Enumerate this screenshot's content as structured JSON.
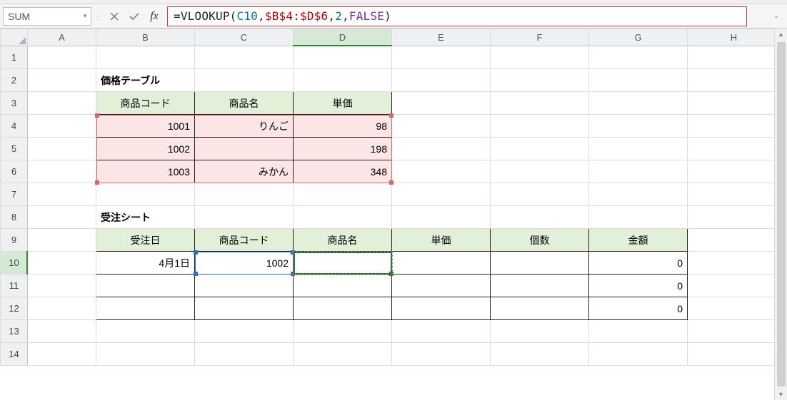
{
  "name_box": "SUM",
  "formula_tokens": [
    {
      "t": "=VLOOKUP",
      "c": "black"
    },
    {
      "t": "(",
      "c": "black"
    },
    {
      "t": "C10",
      "c": "blue"
    },
    {
      "t": ",",
      "c": "black"
    },
    {
      "t": "$B$4:$D$6",
      "c": "red"
    },
    {
      "t": ",",
      "c": "black"
    },
    {
      "t": "2",
      "c": "green"
    },
    {
      "t": ",",
      "c": "black"
    },
    {
      "t": "FALSE",
      "c": "purple"
    },
    {
      "t": ")",
      "c": "black"
    }
  ],
  "columns": [
    "A",
    "B",
    "C",
    "D",
    "E",
    "F",
    "G",
    "H"
  ],
  "rows": [
    "1",
    "2",
    "3",
    "4",
    "5",
    "6",
    "7",
    "8",
    "9",
    "10",
    "11",
    "12",
    "13",
    "14"
  ],
  "active_col": "D",
  "active_row": "10",
  "cells": {
    "B2": {
      "v": "価格テーブル",
      "align": "aL",
      "cls": "bold"
    },
    "B3": {
      "v": "商品コード",
      "style": "greenhdr"
    },
    "C3": {
      "v": "商品名",
      "style": "greenhdr"
    },
    "D3": {
      "v": "単価",
      "style": "greenhdr"
    },
    "B4": {
      "v": "1001",
      "style": "pink",
      "align": "aR"
    },
    "C4": {
      "v": "りんご",
      "style": "pink",
      "align": "aR"
    },
    "D4": {
      "v": "98",
      "style": "pink",
      "align": "aR"
    },
    "B5": {
      "v": "1002",
      "style": "pink",
      "align": "aR"
    },
    "C5": {
      "v": "",
      "style": "pink"
    },
    "D5": {
      "v": "198",
      "style": "pink",
      "align": "aR"
    },
    "B6": {
      "v": "1003",
      "style": "pink",
      "align": "aR"
    },
    "C6": {
      "v": "みかん",
      "style": "pink",
      "align": "aR"
    },
    "D6": {
      "v": "348",
      "style": "pink",
      "align": "aR"
    },
    "B8": {
      "v": "受注シート",
      "align": "aL",
      "cls": "bold"
    },
    "B9": {
      "v": "受注日",
      "style": "greenhdr"
    },
    "C9": {
      "v": "商品コード",
      "style": "greenhdr"
    },
    "D9": {
      "v": "商品名",
      "style": "greenhdr"
    },
    "E9": {
      "v": "単価",
      "style": "greenhdr"
    },
    "F9": {
      "v": "個数",
      "style": "greenhdr"
    },
    "G9": {
      "v": "金額",
      "style": "greenhdr"
    },
    "B10": {
      "v": "4月1日",
      "style": "bordered",
      "align": "aR"
    },
    "C10": {
      "v": "1002",
      "style": "bordered",
      "align": "aR"
    },
    "D10": {
      "v": "",
      "style": "bordered"
    },
    "E10": {
      "v": "",
      "style": "bordered"
    },
    "F10": {
      "v": "",
      "style": "bordered"
    },
    "G10": {
      "v": "0",
      "style": "bordered",
      "align": "aR"
    },
    "B11": {
      "v": "",
      "style": "bordered"
    },
    "C11": {
      "v": "",
      "style": "bordered"
    },
    "D11": {
      "v": "",
      "style": "bordered"
    },
    "E11": {
      "v": "",
      "style": "bordered"
    },
    "F11": {
      "v": "",
      "style": "bordered"
    },
    "G11": {
      "v": "0",
      "style": "bordered",
      "align": "aR"
    },
    "B12": {
      "v": "",
      "style": "bordered"
    },
    "C12": {
      "v": "",
      "style": "bordered"
    },
    "D12": {
      "v": "",
      "style": "bordered"
    },
    "E12": {
      "v": "",
      "style": "bordered"
    },
    "F12": {
      "v": "",
      "style": "bordered"
    },
    "G12": {
      "v": "0",
      "style": "bordered",
      "align": "aR"
    }
  }
}
